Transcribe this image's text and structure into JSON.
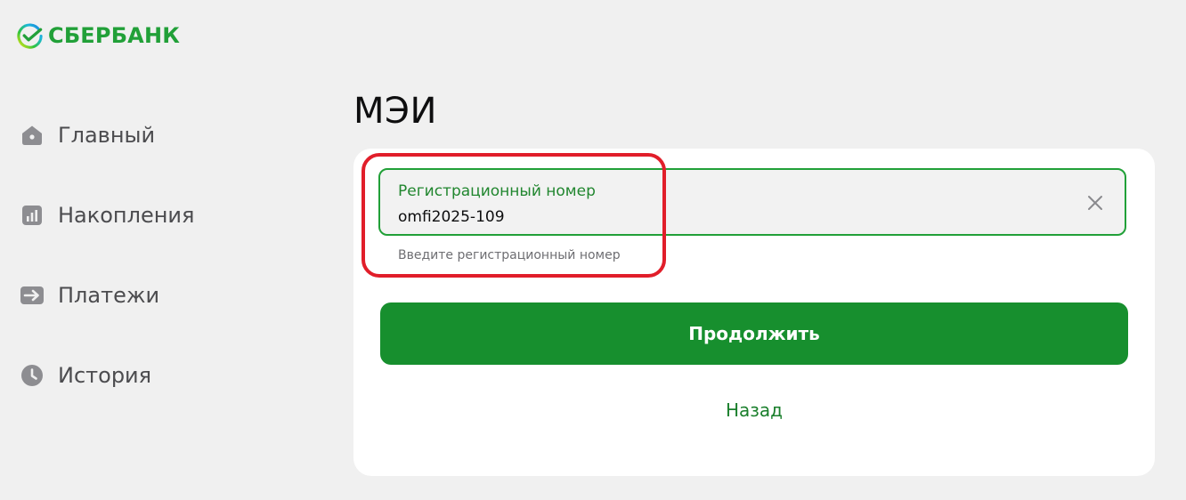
{
  "brand": {
    "name": "СБЕРБАНК",
    "color": "#21a038"
  },
  "sidebar": {
    "items": [
      {
        "label": "Главный",
        "icon": "home-icon"
      },
      {
        "label": "Накопления",
        "icon": "bar-chart-icon"
      },
      {
        "label": "Платежи",
        "icon": "arrow-right-icon"
      },
      {
        "label": "История",
        "icon": "clock-icon"
      }
    ]
  },
  "main": {
    "title": "МЭИ",
    "form": {
      "field_label": "Регистрационный номер",
      "field_value": "omfi2025-109",
      "field_hint": "Введите регистрационный номер",
      "clear_icon": "close-icon",
      "continue_label": "Продолжить",
      "back_label": "Назад"
    }
  },
  "colors": {
    "accent": "#21a038",
    "button": "#178f2e",
    "highlight": "#e11e2a",
    "background": "#f0f0f0"
  }
}
